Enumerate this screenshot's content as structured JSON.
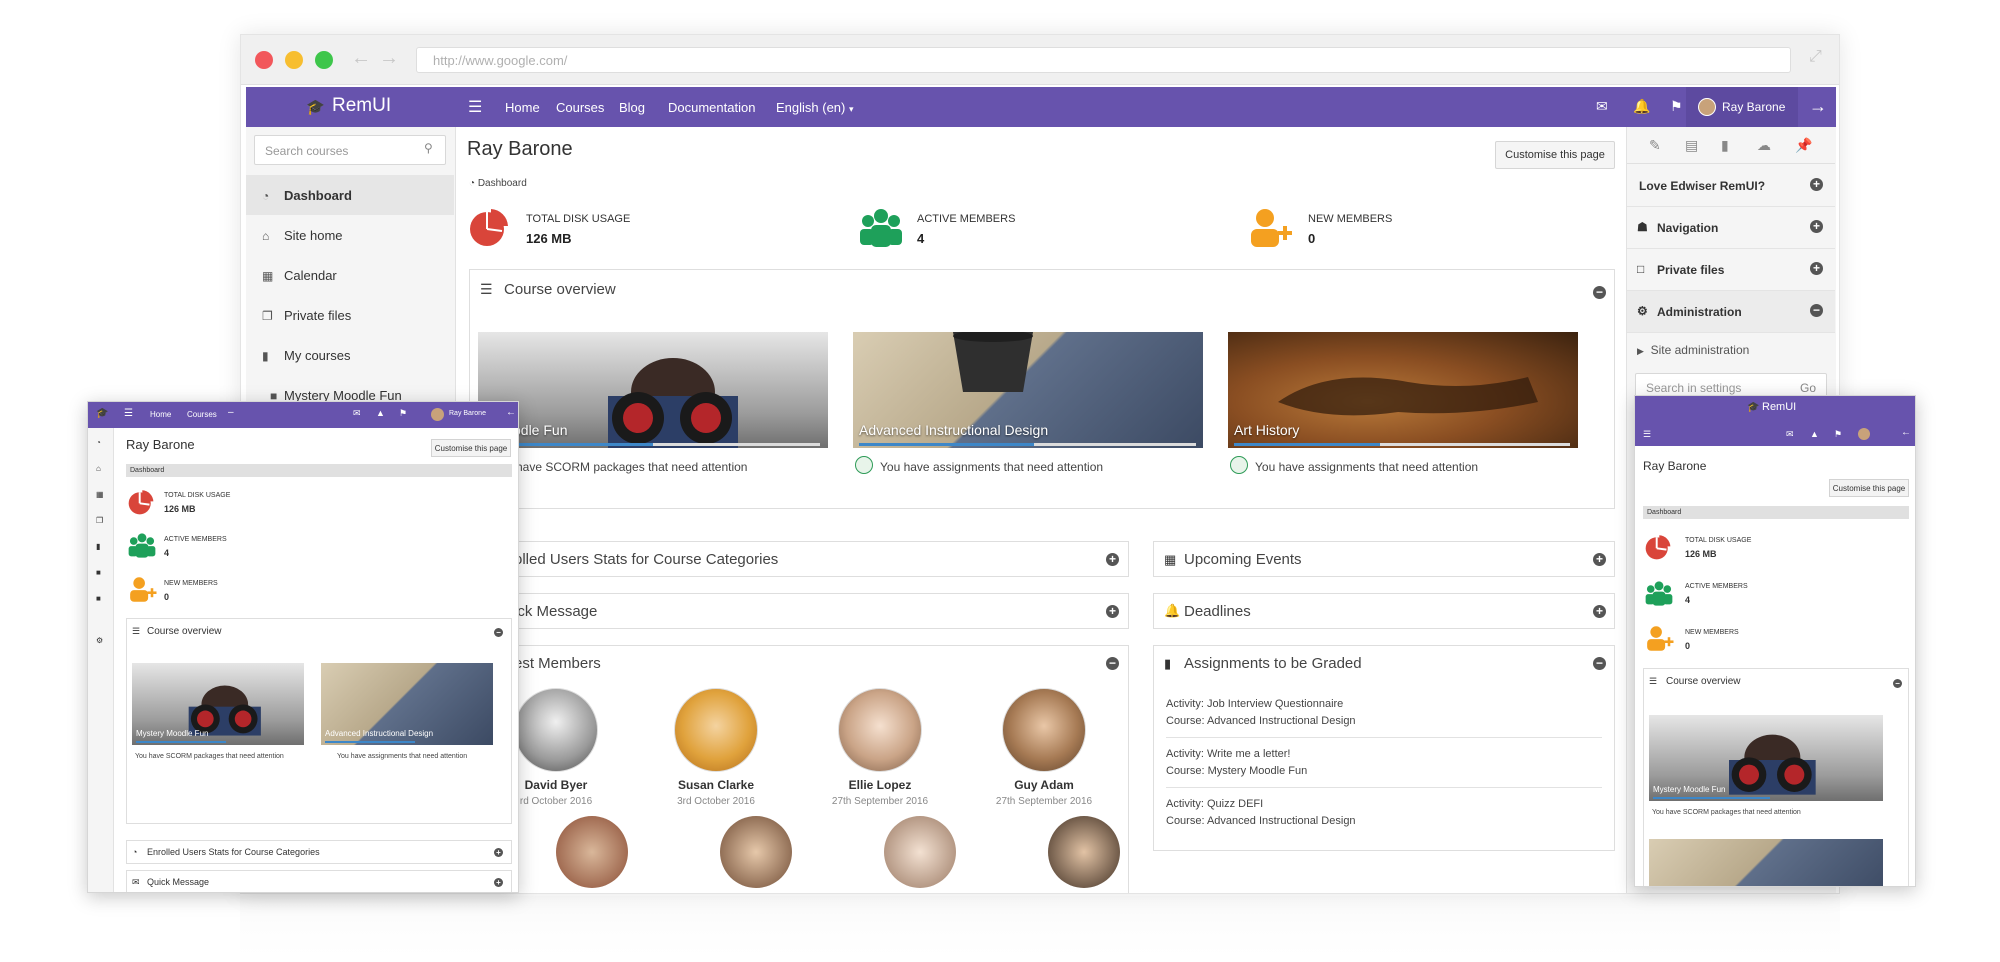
{
  "browser": {
    "url": "http://www.google.com/"
  },
  "nav": {
    "brand": "RemUI",
    "links": [
      "Home",
      "Courses",
      "Blog",
      "Documentation",
      "English (en)"
    ],
    "user_name": "Ray Barone"
  },
  "left_drawer": {
    "search_placeholder": "Search courses",
    "items": [
      "Dashboard",
      "Site home",
      "Calendar",
      "Private files",
      "My courses",
      "Mystery Moodle Fun"
    ]
  },
  "right_drawer": {
    "blocks": [
      "Love Edwiser RemUI?",
      "Navigation",
      "Private files",
      "Administration"
    ],
    "sub_item": "Site administration",
    "settings_placeholder": "Search in settings",
    "go_label": "Go"
  },
  "page": {
    "title": "Ray Barone",
    "customise_label": "Customise this page",
    "breadcrumb": "Dashboard"
  },
  "stats": [
    {
      "label": "TOTAL DISK USAGE",
      "value": "126 MB"
    },
    {
      "label": "ACTIVE MEMBERS",
      "value": "4"
    },
    {
      "label": "NEW MEMBERS",
      "value": "0"
    }
  ],
  "course_overview": {
    "title": "Course overview",
    "courses": [
      {
        "name": "Mystery Moodle Fun",
        "alert": "You have SCORM packages that need attention",
        "progress": 0.5
      },
      {
        "name": "Advanced Instructional Design",
        "alert": "You have assignments that need attention",
        "progress": 0.5
      },
      {
        "name": "Art History",
        "alert": "You have assignments that need attention",
        "progress": 0.5
      }
    ],
    "visible_names": [
      "ry Moodle Fun",
      "Advanced Instructional Design",
      "Art History"
    ],
    "visible_alerts": [
      "u have SCORM packages that need attention",
      "You have assignments that need attention",
      "You have assignments that need attention"
    ]
  },
  "sections": {
    "enrolled": "olled Users Stats for Course Categories",
    "quick_message": "ick Message",
    "latest_members": "est Members",
    "upcoming_events": "Upcoming Events",
    "deadlines": "Deadlines",
    "assignments": "Assignments to be Graded"
  },
  "members": [
    {
      "name": "David Byer",
      "date": "3rd October 2016"
    },
    {
      "name": "Susan Clarke",
      "date": "3rd October 2016"
    },
    {
      "name": "Ellie Lopez",
      "date": "27th September 2016"
    },
    {
      "name": "Guy Adam",
      "date": "27th September 2016"
    }
  ],
  "members_visible": [
    "David Byer",
    "Susan Clarke",
    "Ellie Lopez",
    "Guy Adam"
  ],
  "member_dates_visible": [
    "rd October 2016",
    "3rd October 2016",
    "27th September 2016",
    "27th September 2016"
  ],
  "assignments": [
    {
      "activity": "Activity: Job Interview Questionnaire",
      "course": "Course: Advanced Instructional Design"
    },
    {
      "activity": "Activity: Write me a letter!",
      "course": "Course: Mystery Moodle Fun"
    },
    {
      "activity": "Activity: Quizz DEFI",
      "course": "Course: Advanced Instructional Design"
    }
  ],
  "tablet": {
    "nav_links": [
      "Home",
      "Courses"
    ],
    "user_name": "Ray Barone",
    "title": "Ray Barone",
    "customise_label": "Customise this page",
    "breadcrumb": "Dashboard",
    "course_overview": "Course overview",
    "course_names": [
      "Mystery Moodle Fun",
      "Advanced Instructional Design"
    ],
    "alerts": [
      "You have SCORM packages that need attention",
      "You have assignments that need attention"
    ],
    "enrolled": "Enrolled Users Stats for Course Categories",
    "quick_message": "Quick Message"
  },
  "mobile": {
    "brand": "RemUI",
    "title": "Ray Barone",
    "customise_label": "Customise this page",
    "breadcrumb": "Dashboard",
    "course_overview": "Course overview",
    "course_name": "Mystery Moodle Fun",
    "alert": "You have SCORM packages that need attention"
  },
  "colors": {
    "brand_purple": "#6753ad",
    "pie_red": "#d9453a",
    "members_green": "#1ea05a",
    "new_members_orange": "#f4a020",
    "progress_blue": "#3d87c8"
  },
  "icons": [
    "graduation-cap-icon",
    "hamburger-icon",
    "envelope-icon",
    "bell-icon",
    "flag-icon",
    "arrow-right-icon",
    "search-icon",
    "dashboard-icon",
    "home-icon",
    "calendar-icon",
    "files-icon",
    "book-icon",
    "folder-icon",
    "pie-chart-icon",
    "users-icon",
    "user-plus-icon",
    "minus-circle-icon",
    "plus-circle-icon",
    "sitemap-icon",
    "folder-open-icon",
    "cogs-icon"
  ]
}
